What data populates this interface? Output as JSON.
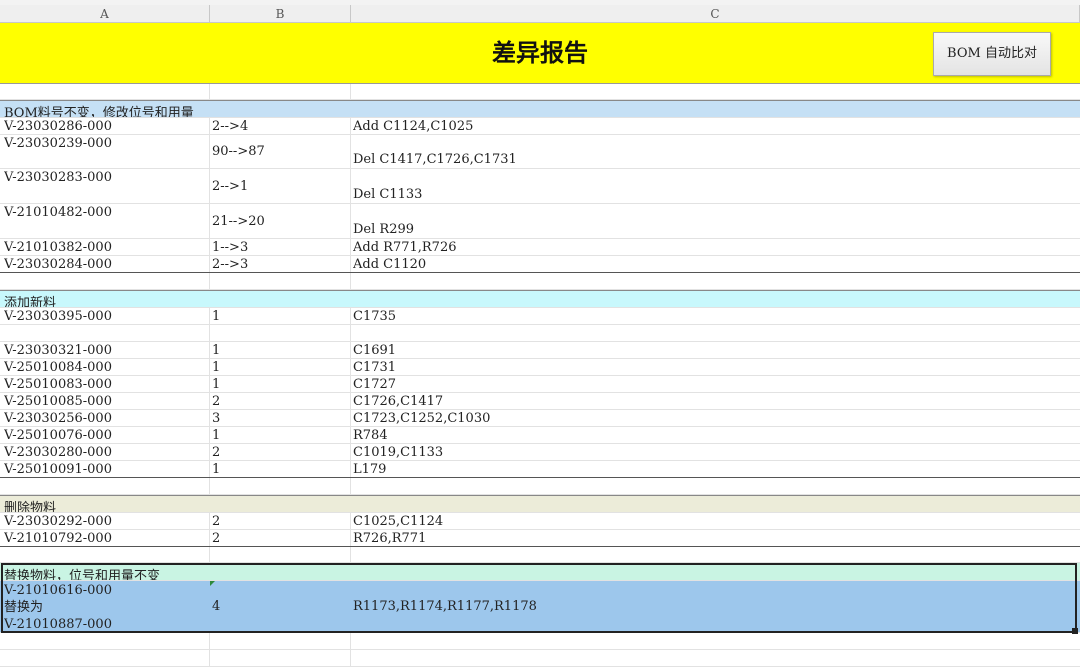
{
  "columns": [
    "A",
    "B",
    "C"
  ],
  "title": "差异报告",
  "compare_button": "BOM 自动比对",
  "sections": {
    "modify": {
      "header": "BOM料号不变，修改位号和用量",
      "rows": [
        {
          "part": "V-23030286-000",
          "qty": "2-->4",
          "ref": "Add C1124,C1025"
        },
        {
          "part": "V-23030239-000",
          "qty": "90-->87",
          "ref": "Del C1417,C1726,C1731"
        },
        {
          "part": "V-23030283-000",
          "qty": "2-->1",
          "ref": "Del C1133"
        },
        {
          "part": "V-21010482-000",
          "qty": "21-->20",
          "ref": "Del R299"
        },
        {
          "part": "V-21010382-000",
          "qty": "1-->3",
          "ref": "Add R771,R726"
        },
        {
          "part": "V-23030284-000",
          "qty": "2-->3",
          "ref": "Add C1120"
        }
      ]
    },
    "added": {
      "header": "添加新料",
      "rows": [
        {
          "part": "V-23030395-000",
          "qty": "1",
          "ref": "C1735"
        },
        {
          "part": "",
          "qty": "",
          "ref": ""
        },
        {
          "part": "V-23030321-000",
          "qty": "1",
          "ref": "C1691"
        },
        {
          "part": "V-25010084-000",
          "qty": "1",
          "ref": "C1731"
        },
        {
          "part": "V-25010083-000",
          "qty": "1",
          "ref": "C1727"
        },
        {
          "part": "V-25010085-000",
          "qty": "2",
          "ref": "C1726,C1417"
        },
        {
          "part": "V-23030256-000",
          "qty": "3",
          "ref": "C1723,C1252,C1030"
        },
        {
          "part": "V-25010076-000",
          "qty": "1",
          "ref": "R784"
        },
        {
          "part": "V-23030280-000",
          "qty": "2",
          "ref": "C1019,C1133"
        },
        {
          "part": "V-25010091-000",
          "qty": "1",
          "ref": "L179"
        }
      ]
    },
    "deleted": {
      "header": "删除物料",
      "rows": [
        {
          "part": "V-23030292-000",
          "qty": "2",
          "ref": "C1025,C1124"
        },
        {
          "part": "V-21010792-000",
          "qty": "2",
          "ref": "R726,R771"
        }
      ]
    },
    "replaced": {
      "header": "替换物料，位号和用量不变",
      "row": {
        "line1": "V-21010616-000",
        "line2": "替换为",
        "line3": "V-21010887-000",
        "qty": "4",
        "ref": "R1173,R1174,R1177,R1178"
      }
    }
  }
}
